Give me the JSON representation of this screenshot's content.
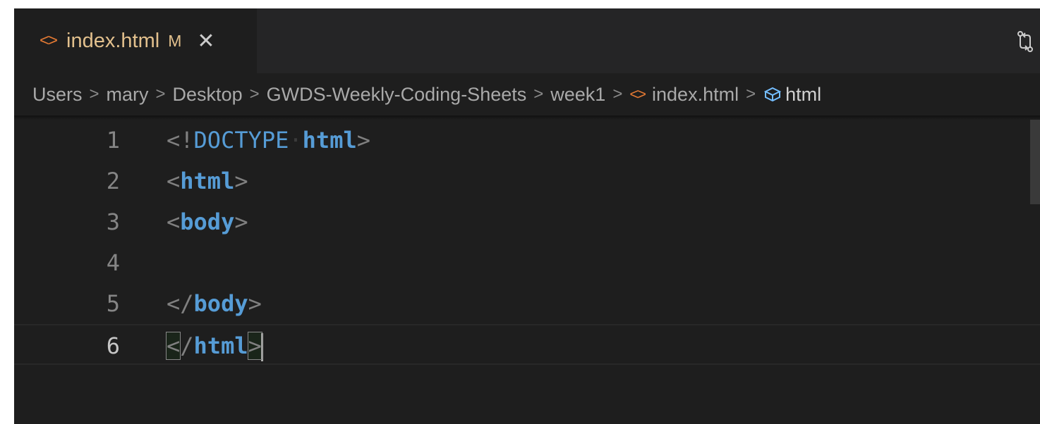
{
  "tab": {
    "icon": "html-file-icon",
    "filename": "index.html",
    "status": "M",
    "close": "✕"
  },
  "tab_actions": {
    "compare_icon": "git-compare-icon"
  },
  "breadcrumbs": {
    "items": [
      "Users",
      "mary",
      "Desktop",
      "GWDS-Weekly-Coding-Sheets",
      "week1",
      "index.html",
      "html"
    ],
    "separator": ">"
  },
  "editor": {
    "lines": [
      {
        "number": "1",
        "open": "<!",
        "tag": "DOCTYPE",
        "space": "·",
        "attr": "html",
        "close": ">"
      },
      {
        "number": "2",
        "open": "<",
        "tag": "html",
        "close": ">"
      },
      {
        "number": "3",
        "open": "<",
        "tag": "body",
        "close": ">"
      },
      {
        "number": "4"
      },
      {
        "number": "5",
        "open": "</",
        "tag": "body",
        "close": ">"
      },
      {
        "number": "6",
        "open_lt": "<",
        "open_slash": "/",
        "tag": "html",
        "close": ">"
      }
    ],
    "active_line": 6
  },
  "colors": {
    "editor_bg": "#1e1e1e",
    "tabbar_bg": "#252526",
    "keyword": "#569cd6",
    "punctuation": "#808080",
    "modified": "#e2c08d",
    "html_icon": "#e37933"
  }
}
